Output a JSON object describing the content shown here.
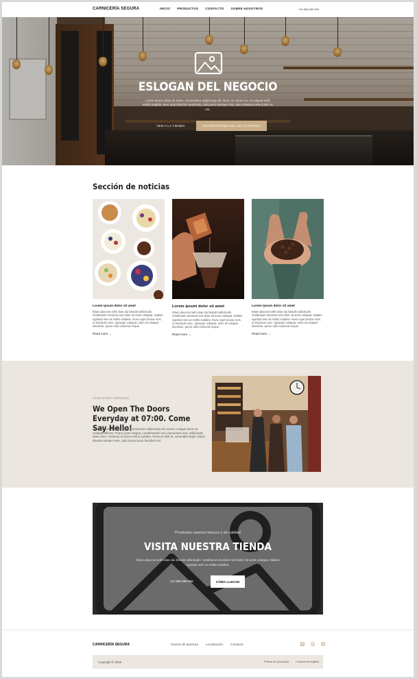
{
  "header": {
    "brand": "CARNICERÍA SEGURA",
    "nav": [
      "INICIO",
      "PRODUCTOS",
      "CONTACTO",
      "SOBRE NOSOTROS"
    ],
    "phone": "+34 958 999 999"
  },
  "hero": {
    "title": "ESLOGAN DEL NEGOCIO",
    "text": "Lorem ipsum dolor sit amet, consectetur adipiscing elit. Nunc ut rutrum ex, eu aliquet velit. Morbi sagittis, sem quis lobortis commodo, nisi purus semper nisi, quis volutpat tortor justo ac est.",
    "btn_primary": "VEN A LA TIENDA",
    "btn_secondary": "VALORACIONES DE LOS CLIENTES",
    "image_icon": "image-placeholder-icon"
  },
  "news": {
    "title": "Sección de noticias",
    "cards": [
      {
        "title": "Lorem ipsum dolor sit amet",
        "body": "Etiam placerat velit vitae dui blandit sollicitudin. Vestibulum tincidunt sed dolor sit amet volutpat. Nullam egestas sem at mollis sodales. Nunc eget lacinia eros, ut tincidunt nunc. Quisque volutpat, enim id volutpat interdum, purus odio euismod neque.",
        "link": "Read more →"
      },
      {
        "title": "Lorem ipsum dolor sit amet",
        "body": "Etiam placerat velit vitae dui blandit sollicitudin. Vestibulum tincidunt sed dolor sit amet volutpat. Nullam egestas sem at mollis sodales. Nunc eget lacinia eros, ut tincidunt nunc. Quisque volutpat, enim id volutpat interdum, purus odio euismod neque.",
        "link": "Read more →"
      },
      {
        "title": "Lorem ipsum dolor sit amet",
        "body": "Etiam placerat velit vitae dui blandit sollicitudin. Vestibulum tincidunt sed dolor sit amet volutpat. Nullam egestas sem at mollis sodales. Nunc eget lacinia eros, ut tincidunt nunc. Quisque volutpat, enim id volutpat interdum, purus odio euismod neque.",
        "link": "Read more →"
      }
    ]
  },
  "open": {
    "kicker": "OPEN EVERY MORNING",
    "title": "We Open The Doors Everyday at 07:00. Come Say Hello!",
    "body": "Lorem ipsum dolor sit amet, consectetur adipiscing elit. Donec congue lorem ut volutpat efficitur. Fusce justo magna, condimentum nec elementum sed, sollicitudin vitae enim. Vivamus sit amet metus porttitor, rhoncus nibh et, venenatis turpis. Etiam lobortis semper ante, quis luctus lacus tincidunt vel."
  },
  "visit": {
    "subtitle": "Productos caseros frescos y de calidad",
    "title": "VISITA NUESTRA TIENDA",
    "text": "Etiam placerat velit vitae dui blandit sollicitudin. Vestibulum tincidunt sed dolor sit amet volutpat. Nullam egestas sem at mollis sodales.",
    "phone": "+34 958 999 999",
    "button": "CÓMO LLEGAR"
  },
  "footer": {
    "brand": "CARNICERÍA SEGURA",
    "links": [
      "Horario de apertura",
      "Localización",
      "Contacto"
    ],
    "social": [
      "linkedin-icon",
      "facebook-icon",
      "instagram-icon"
    ],
    "copyright": "Copyright © 2025",
    "legal": [
      "Política de privacidad",
      "Condiciones legales"
    ]
  },
  "colors": {
    "accent": "#c8ad8a",
    "beige_bg": "#ebe6df",
    "dark_block": "#2a2a2a"
  }
}
